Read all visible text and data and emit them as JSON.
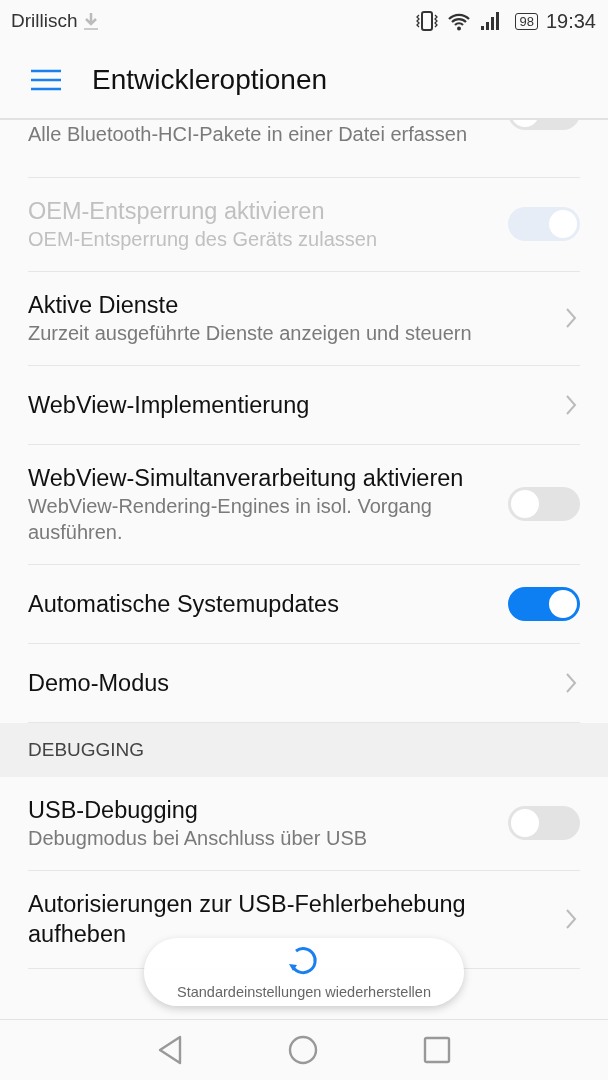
{
  "status_bar": {
    "carrier": "Drillisch",
    "battery": "98",
    "time": "19:34"
  },
  "app_bar": {
    "title": "Entwickleroptionen"
  },
  "items": [
    {
      "kind": "toggle",
      "subtitle": "Alle Bluetooth-HCI-Pakete in einer Datei erfassen",
      "on": false,
      "disabled": false,
      "cut": true
    },
    {
      "kind": "toggle",
      "title": "OEM-Entsperrung aktivieren",
      "subtitle": "OEM-Entsperrung des Geräts zulassen",
      "on": true,
      "disabled": true
    },
    {
      "kind": "link",
      "title": "Aktive Dienste",
      "subtitle": "Zurzeit ausgeführte Dienste anzeigen und steuern",
      "disabled": false
    },
    {
      "kind": "link",
      "title": "WebView-Implementierung",
      "disabled": false
    },
    {
      "kind": "toggle",
      "title": "WebView-Simultanverarbeitung aktivieren",
      "subtitle": "WebView-Rendering-Engines in isol. Vorgang ausführen.",
      "on": false,
      "disabled": false
    },
    {
      "kind": "toggle",
      "title": "Automatische Systemupdates",
      "on": true,
      "disabled": false
    },
    {
      "kind": "link",
      "title": "Demo-Modus",
      "disabled": false
    },
    {
      "kind": "header",
      "title": "DEBUGGING"
    },
    {
      "kind": "toggle",
      "title": "USB-Debugging",
      "subtitle": "Debugmodus bei Anschluss über USB",
      "on": false,
      "disabled": false
    },
    {
      "kind": "link",
      "title": "Autorisierungen zur USB-Fehlerbehebung aufheben",
      "disabled": false
    }
  ],
  "toast": {
    "text": "Standardeinstellungen wiederherstellen"
  }
}
